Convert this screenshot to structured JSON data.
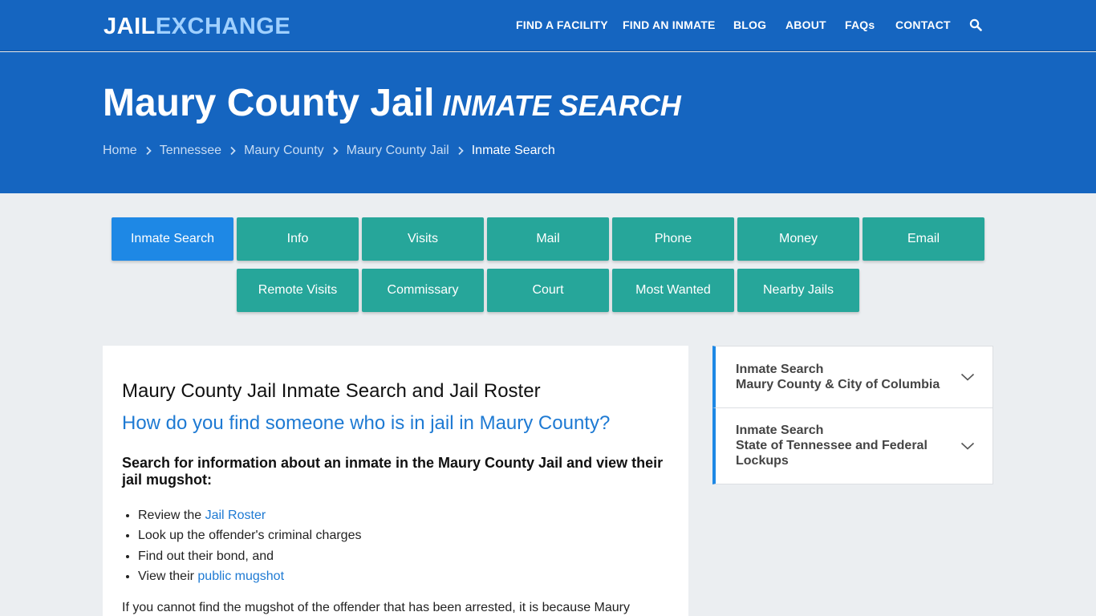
{
  "header": {
    "logo_part1": "JAIL",
    "logo_part2": "EXCHANGE",
    "nav": [
      {
        "label": "FIND A FACILITY"
      },
      {
        "label": "FIND AN INMATE"
      },
      {
        "label": "BLOG"
      },
      {
        "label": "ABOUT"
      },
      {
        "label": "FAQs"
      },
      {
        "label": "CONTACT"
      }
    ],
    "search_icon": "search-icon"
  },
  "hero": {
    "title": "Maury County Jail",
    "subtitle": "INMATE SEARCH",
    "breadcrumb": [
      {
        "label": "Home"
      },
      {
        "label": "Tennessee"
      },
      {
        "label": "Maury County"
      },
      {
        "label": "Maury County Jail"
      },
      {
        "label": "Inmate Search"
      }
    ]
  },
  "tabs": {
    "row1": [
      {
        "label": "Inmate Search",
        "active": true
      },
      {
        "label": "Info"
      },
      {
        "label": "Visits"
      },
      {
        "label": "Mail"
      },
      {
        "label": "Phone"
      },
      {
        "label": "Money"
      },
      {
        "label": "Email"
      }
    ],
    "row2": [
      {
        "label": "Remote Visits"
      },
      {
        "label": "Commissary"
      },
      {
        "label": "Court"
      },
      {
        "label": "Most Wanted"
      },
      {
        "label": "Nearby Jails"
      }
    ]
  },
  "content": {
    "heading": "Maury County Jail Inmate Search and Jail Roster",
    "question": "How do you find someone who is in jail in Maury County?",
    "lead": "Search for information about an inmate in the Maury County Jail and view their jail mugshot:",
    "list": [
      {
        "prefix": "Review the ",
        "link": "Jail Roster",
        "suffix": ""
      },
      {
        "prefix": "Look up the offender's criminal charges",
        "link": "",
        "suffix": ""
      },
      {
        "prefix": "Find out their bond, and",
        "link": "",
        "suffix": ""
      },
      {
        "prefix": "View their ",
        "link": "public mugshot",
        "suffix": ""
      }
    ],
    "paragraph": "If you cannot find the mugshot of the offender that has been arrested, it is because Maury"
  },
  "sidebar": [
    {
      "title": "Inmate Search",
      "subtitle": "Maury County & City of Columbia"
    },
    {
      "title": "Inmate Search",
      "subtitle": "State of Tennessee and Federal Lockups"
    }
  ],
  "colors": {
    "header_blue": "#1565c0",
    "tab_teal": "#26a69a",
    "tab_active": "#1e88e5",
    "link_blue": "#1e7ad3",
    "logo_accent": "#9fd0ff"
  }
}
